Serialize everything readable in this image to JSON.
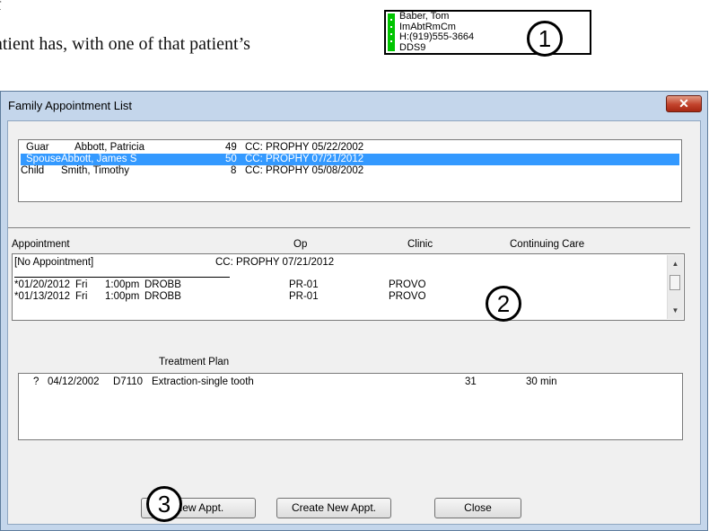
{
  "document": {
    "line1": "f",
    "line2": "atient has, with one of that patient’s"
  },
  "appt_card": {
    "lines": [
      "Baber, Tom",
      "ImAbtRmCm",
      "H:(919)555-3664",
      "DDS9"
    ]
  },
  "callouts": [
    "1",
    "2",
    "3"
  ],
  "window": {
    "title": "Family Appointment List",
    "close_glyph": "✕"
  },
  "family_list": {
    "rows": [
      {
        "role": "Guar",
        "name": "Abbott, Patricia",
        "age": "49",
        "cc": "CC: PROPHY 05/22/2002",
        "selected": false
      },
      {
        "role": "Spouse",
        "name": "Abbott, James S",
        "age": "50",
        "cc": "CC: PROPHY 07/21/2012",
        "selected": true
      },
      {
        "role": "Child",
        "name": "Smith, Timothy",
        "age": "8",
        "cc": "CC: PROPHY 05/08/2002",
        "selected": false
      }
    ]
  },
  "appointments": {
    "headers": {
      "appointment": "Appointment",
      "op": "Op",
      "clinic": "Clinic",
      "continuing_care": "Continuing Care"
    },
    "no_appt": "[No Appointment]",
    "no_appt_cc": "CC: PROPHY 07/21/2012",
    "rows": [
      {
        "date": "*01/20/2012",
        "day": "Fri",
        "time": "1:00pm",
        "provider": "DROBB",
        "op": "PR-01",
        "clinic": "PROVO"
      },
      {
        "date": "*01/13/2012",
        "day": "Fri",
        "time": "1:00pm",
        "provider": "DROBB",
        "op": "PR-01",
        "clinic": "PROVO"
      }
    ]
  },
  "treatment_plan": {
    "header": "Treatment Plan",
    "rows": [
      {
        "status": "?",
        "date": "04/12/2002",
        "code": "D7110",
        "desc": "Extraction-single tooth",
        "tooth": "31",
        "duration": "30 min"
      }
    ]
  },
  "buttons": {
    "view": "View Appt.",
    "create": "Create New Appt.",
    "close": "Close"
  }
}
